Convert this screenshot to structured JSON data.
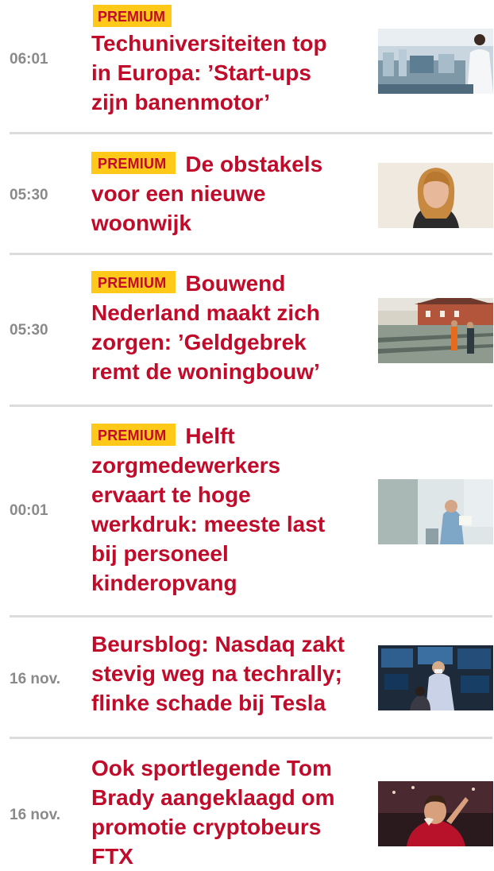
{
  "premium_label": "PREMIUM",
  "articles": [
    {
      "time": "06:01",
      "premium": true,
      "badge_inline": false,
      "title": "Techuniversiteiten top in Europa: ’Start-ups zijn banenmotor’",
      "image": "laboratory-photo"
    },
    {
      "time": "05:30",
      "premium": true,
      "badge_inline": true,
      "title": "De obstakels voor een nieuwe woonwijk",
      "image": "portrait-photo"
    },
    {
      "time": "05:30",
      "premium": true,
      "badge_inline": true,
      "title": "Bouwend Nederland maakt zich zorgen: ’Geldgebrek remt de woningbouw’",
      "image": "construction-site-photo"
    },
    {
      "time": "00:01",
      "premium": true,
      "badge_inline": true,
      "title": "Helft zorgmedewerkers ervaart te hoge werkdruk: meeste last bij personeel kinderopvang",
      "image": "healthcare-worker-photo"
    },
    {
      "time": "16 nov.",
      "premium": false,
      "badge_inline": false,
      "title": "Beursblog: Nasdaq zakt stevig weg na techrally; flinke schade bij Tesla",
      "image": "stock-exchange-photo"
    },
    {
      "time": "16 nov.",
      "premium": false,
      "badge_inline": false,
      "title": "Ook sportlegende Tom Brady aangeklaagd om promotie cryptobeurs FTX",
      "image": "football-player-photo"
    }
  ],
  "colors": {
    "headline": "#c00b2a",
    "badge_bg": "#ffc91a",
    "time": "#8a8a8a",
    "divider": "#dcdcdc"
  }
}
